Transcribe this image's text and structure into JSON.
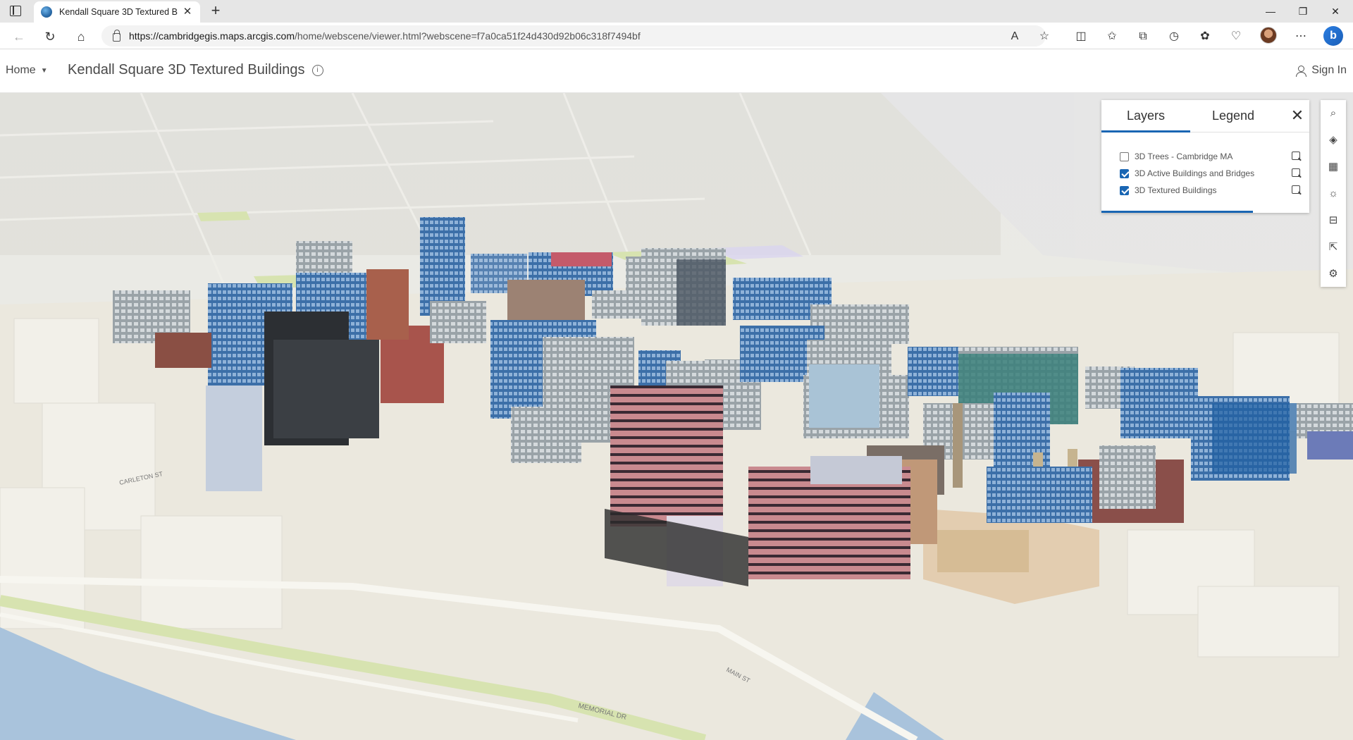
{
  "browser": {
    "tab_title": "Kendall Square 3D Textured Build",
    "url_host": "https://cambridgegis.maps.arcgis.com",
    "url_path": "/home/webscene/viewer.html?webscene=f7a0ca51f24d430d92b06c318f7494bf"
  },
  "header": {
    "home_label": "Home",
    "title": "Kendall Square 3D Textured Buildings",
    "signin_label": "Sign In"
  },
  "panel": {
    "tabs": [
      "Layers",
      "Legend"
    ],
    "active_tab": "Layers",
    "layers": [
      {
        "label": "3D Trees - Cambridge MA",
        "checked": false
      },
      {
        "label": "3D Active Buildings and Bridges",
        "checked": true
      },
      {
        "label": "3D Textured Buildings",
        "checked": true
      }
    ]
  },
  "toolbar": {
    "tools": [
      "search-icon",
      "layers-icon",
      "basemap-icon",
      "daylight-icon",
      "measure-icon",
      "share-icon",
      "settings-icon"
    ]
  },
  "map": {
    "street_labels": [
      "CARLETON ST",
      "MAIN ST",
      "MEMORIAL DR"
    ],
    "colors": {
      "ground": "#ebe8de",
      "park": "#d7e3b0",
      "water": "#a9c3dc",
      "brick": "#c98a8f"
    }
  }
}
